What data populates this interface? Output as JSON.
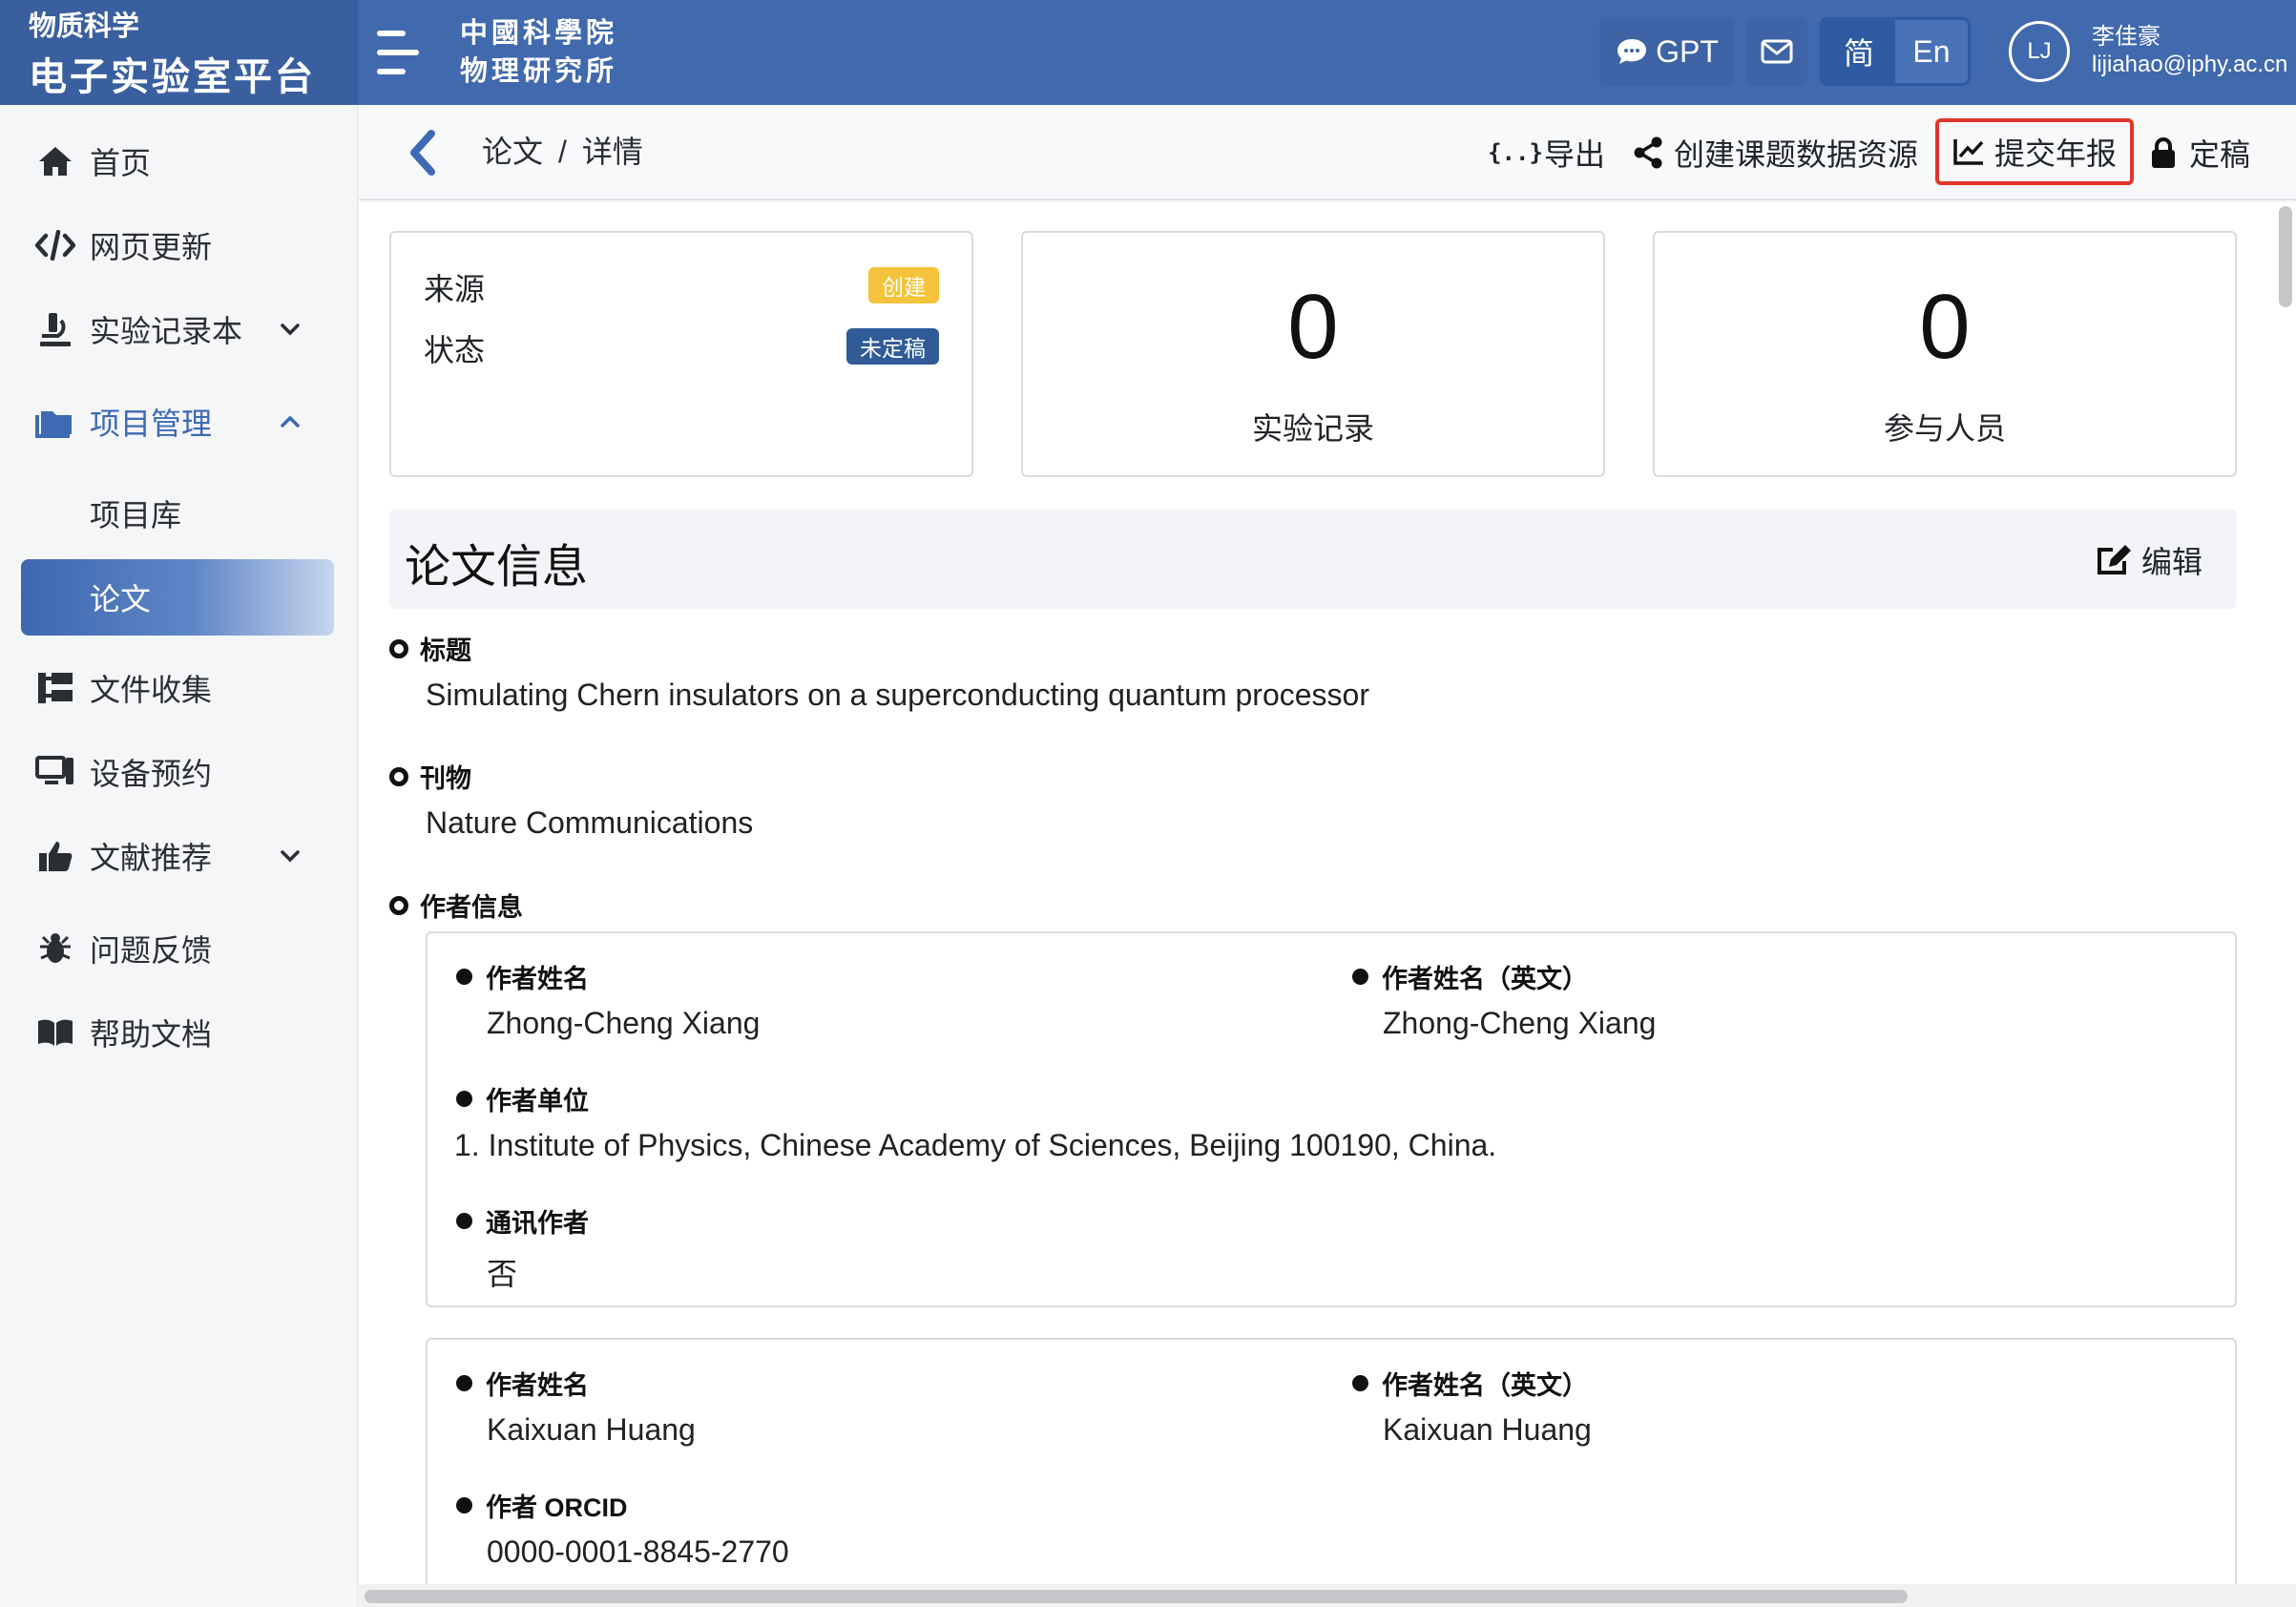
{
  "brand": {
    "subtitle": "物质科学",
    "title": "电子实验室平台"
  },
  "institute": {
    "line1": "中國科學院",
    "line2": "物理研究所"
  },
  "topbar": {
    "gpt_label": "GPT",
    "lang_zh": "简",
    "lang_en": "En",
    "avatar_initials": "LJ",
    "user_name": "李佳豪",
    "user_email": "lijiahao@iphy.ac.cn"
  },
  "sidebar": {
    "items": [
      {
        "label": "首页",
        "icon": "home-icon"
      },
      {
        "label": "网页更新",
        "icon": "code-icon"
      },
      {
        "label": "实验记录本",
        "icon": "microscope-icon"
      },
      {
        "label": "项目管理",
        "icon": "folder-icon"
      },
      {
        "label": "文件收集",
        "icon": "sitemap-icon"
      },
      {
        "label": "设备预约",
        "icon": "desktop-icon"
      },
      {
        "label": "文献推荐",
        "icon": "thumbs-up-icon"
      },
      {
        "label": "问题反馈",
        "icon": "bug-icon"
      },
      {
        "label": "帮助文档",
        "icon": "book-icon"
      }
    ],
    "sub_items": [
      {
        "label": "项目库"
      },
      {
        "label": "论文"
      }
    ]
  },
  "header": {
    "breadcrumb": [
      "论文",
      "详情"
    ],
    "breadcrumb_sep": "/",
    "actions": {
      "export": "导出",
      "create_resource": "创建课题数据资源",
      "annual_report": "提交年报",
      "finalize": "定稿"
    }
  },
  "summary": {
    "source_label": "来源",
    "source_badge": "创建",
    "status_label": "状态",
    "status_badge": "未定稿",
    "records_count": "0",
    "records_label": "实验记录",
    "members_count": "0",
    "members_label": "参与人员"
  },
  "paper": {
    "section_title": "论文信息",
    "edit_label": "编辑",
    "title_label": "标题",
    "title_value": "Simulating Chern insulators on a superconducting quantum processor",
    "journal_label": "刊物",
    "journal_value": "Nature Communications",
    "authors_label": "作者信息",
    "authors": [
      {
        "name_label": "作者姓名",
        "name": "Zhong-Cheng Xiang",
        "name_en_label": "作者姓名（英文）",
        "name_en": "Zhong-Cheng Xiang",
        "affiliation_label": "作者单位",
        "affiliation": "1. Institute of Physics, Chinese Academy of Sciences, Beijing 100190, China.",
        "corresponding_label": "通讯作者",
        "corresponding": "否"
      },
      {
        "name_label": "作者姓名",
        "name": "Kaixuan Huang",
        "name_en_label": "作者姓名（英文）",
        "name_en": "Kaixuan Huang",
        "orcid_label": "作者 ORCID",
        "orcid": "0000-0001-8845-2770"
      }
    ]
  },
  "colors": {
    "topbar": "#4169ad",
    "accent": "#3d6ab3",
    "highlight_border": "#e0352b",
    "badge_yellow": "#f5c33b",
    "badge_navy": "#2f5b97"
  }
}
